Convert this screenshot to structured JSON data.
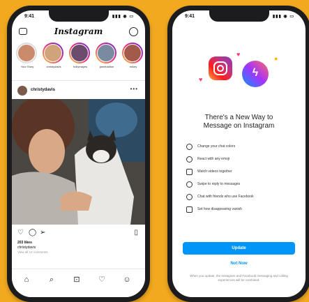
{
  "status_bar": {
    "time": "9:41",
    "signal": "▮▮▮ ◉ ▭"
  },
  "feed": {
    "logo": "Instagram",
    "stories": [
      {
        "name": "Your Story",
        "color": "#c98b6b",
        "seen": true
      },
      {
        "name": "christydavis",
        "color": "#d1a37a",
        "seen": false
      },
      {
        "name": "hollymayes",
        "color": "#6b4b6e",
        "seen": false
      },
      {
        "name": "jamiedalton",
        "color": "#7a8aa0",
        "seen": false
      },
      {
        "name": "mikey",
        "color": "#a35a4a",
        "seen": false
      }
    ],
    "post": {
      "username": "christydavis",
      "more": "•••",
      "likes": "203 likes",
      "caption": "christydavis",
      "comments": "View all 12 comments"
    },
    "tabs": [
      "home",
      "search",
      "reels",
      "activity",
      "profile"
    ]
  },
  "update": {
    "title_line1": "There's a New Way to",
    "title_line2": "Message on Instagram",
    "features": [
      {
        "icon": "smile-icon",
        "text": "Change your chat colors"
      },
      {
        "icon": "reply-icon",
        "text": "React with any emoji"
      },
      {
        "icon": "watch-icon",
        "text": "Watch videos together"
      },
      {
        "icon": "swipe-icon",
        "text": "Swipe to reply to messages"
      },
      {
        "icon": "chat-icon",
        "text": "Chat with friends who use Facebook"
      },
      {
        "icon": "vanish-icon",
        "text": "Set how disappearing vanish"
      }
    ],
    "update_button": "Update",
    "not_now": "Not Now",
    "footer": "When you update, the Instagram and Facebook messaging and calling experiences will be combined."
  },
  "colors": {
    "background": "#f2a91f",
    "accent": "#0095f6"
  }
}
